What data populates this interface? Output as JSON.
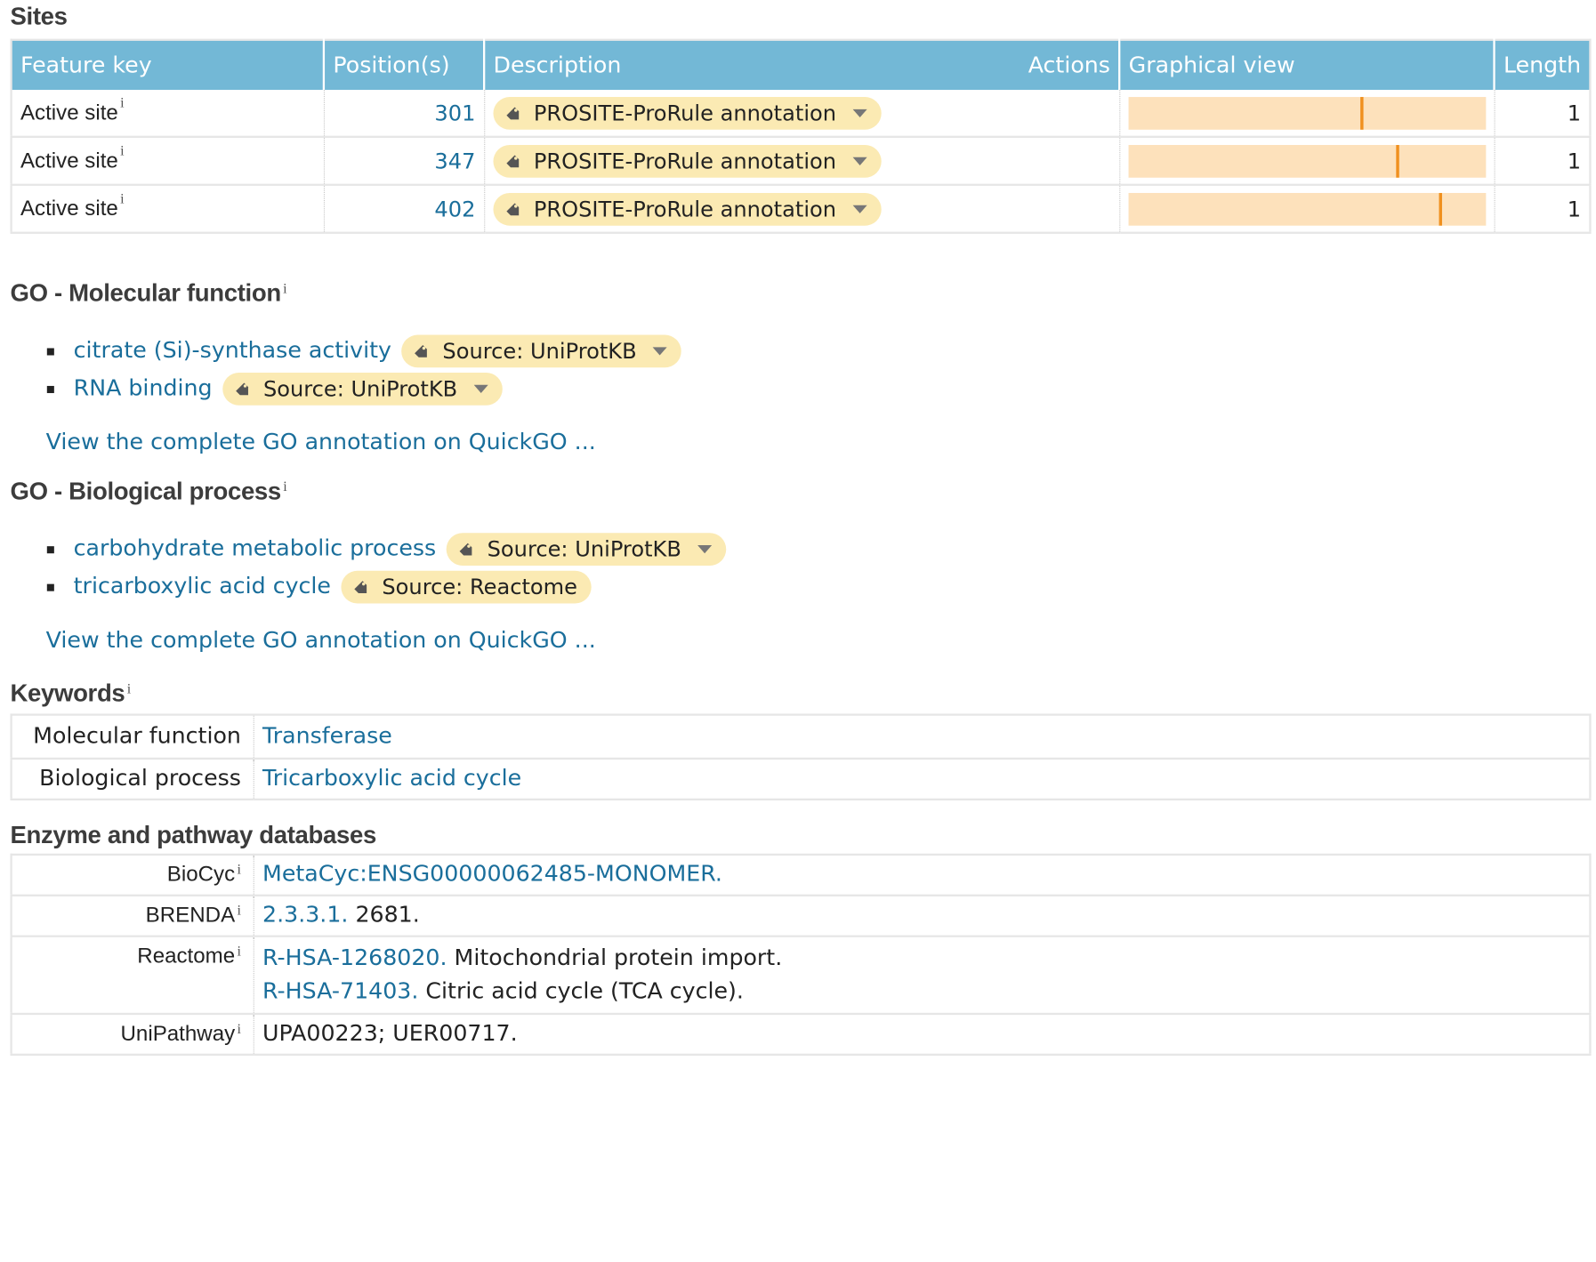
{
  "sites": {
    "title": "Sites",
    "columns": {
      "feature_key": "Feature key",
      "positions": "Position(s)",
      "description": "Description",
      "actions": "Actions",
      "graphical_view": "Graphical view",
      "length": "Length"
    },
    "info_marker": "i",
    "rows": [
      {
        "feature": "Active site",
        "position": "301",
        "description": "PROSITE-ProRule annotation",
        "length": "1",
        "marker_fraction": 0.65
      },
      {
        "feature": "Active site",
        "position": "347",
        "description": "PROSITE-ProRule annotation",
        "length": "1",
        "marker_fraction": 0.75
      },
      {
        "feature": "Active site",
        "position": "402",
        "description": "PROSITE-ProRule annotation",
        "length": "1",
        "marker_fraction": 0.87
      }
    ]
  },
  "go_molecular": {
    "title": "GO - Molecular function",
    "info_marker": "i",
    "items": [
      {
        "term": "citrate (Si)-synthase activity",
        "source": "Source: UniProtKB",
        "has_dropdown": true
      },
      {
        "term": "RNA binding",
        "source": "Source: UniProtKB",
        "has_dropdown": true
      }
    ],
    "more_link": "View the complete GO annotation on QuickGO ..."
  },
  "go_biological": {
    "title": "GO - Biological process",
    "info_marker": "i",
    "items": [
      {
        "term": "carbohydrate metabolic process",
        "source": "Source: UniProtKB",
        "has_dropdown": true
      },
      {
        "term": "tricarboxylic acid cycle",
        "source": "Source: Reactome",
        "has_dropdown": false
      }
    ],
    "more_link": "View the complete GO annotation on QuickGO ..."
  },
  "keywords": {
    "title": "Keywords",
    "info_marker": "i",
    "rows": [
      {
        "key": "Molecular function",
        "value": "Transferase"
      },
      {
        "key": "Biological process",
        "value": "Tricarboxylic acid cycle"
      }
    ]
  },
  "enzyme": {
    "title": "Enzyme and pathway databases",
    "info_marker": "i",
    "biocyc": {
      "name": "BioCyc",
      "link": "MetaCyc:ENSG00000062485-MONOMER."
    },
    "brenda": {
      "name": "BRENDA",
      "link": "2.3.3.1.",
      "text": " 2681."
    },
    "reactome": {
      "name": "Reactome",
      "entries": [
        {
          "link": "R-HSA-1268020.",
          "text": " Mitochondrial protein import."
        },
        {
          "link": "R-HSA-71403.",
          "text": " Citric acid cycle (TCA cycle)."
        }
      ]
    },
    "unipathway": {
      "name": "UniPathway",
      "text": "UPA00223; UER00717."
    }
  },
  "colors": {
    "header_bg": "#73b8d6",
    "link": "#1a6e9b",
    "pill_bg": "#fbeab3",
    "bar_bg": "#fde1bb",
    "bar_marker": "#f0901e"
  }
}
